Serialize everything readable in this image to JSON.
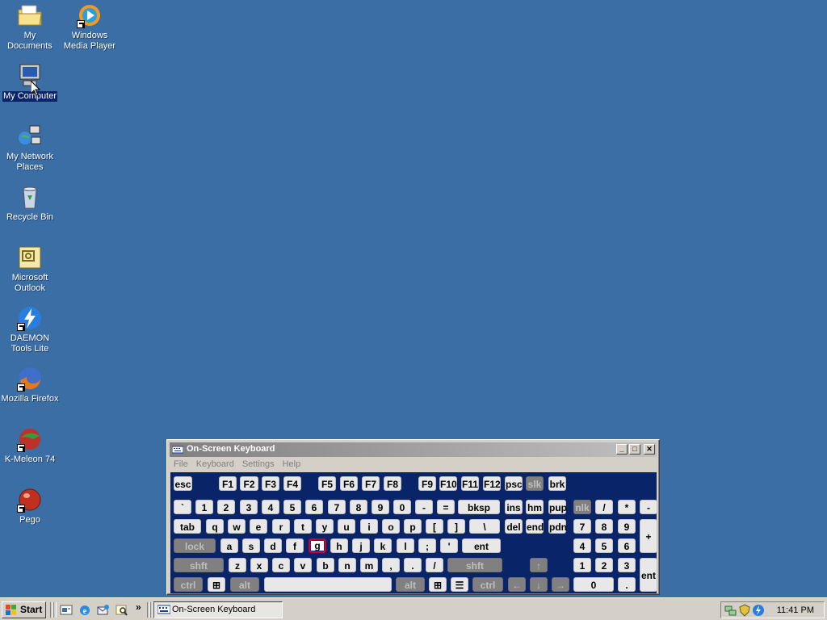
{
  "desktop": {
    "icons": [
      {
        "label": "My Documents",
        "icon": "folder-icon"
      },
      {
        "label": "Windows Media Player",
        "icon": "media-player-icon"
      },
      {
        "label": "My Computer",
        "icon": "computer-icon",
        "selected": true
      },
      {
        "label": "My Network Places",
        "icon": "network-icon"
      },
      {
        "label": "Recycle Bin",
        "icon": "recycle-bin-icon"
      },
      {
        "label": "Microsoft Outlook",
        "icon": "outlook-icon"
      },
      {
        "label": "DAEMON Tools Lite",
        "icon": "daemon-tools-icon"
      },
      {
        "label": "Mozilla Firefox",
        "icon": "firefox-icon"
      },
      {
        "label": "K-Meleon 74",
        "icon": "k-meleon-icon"
      },
      {
        "label": "Pego",
        "icon": "pego-icon"
      }
    ],
    "background_color": "#3a6ea5"
  },
  "osk": {
    "title": "On-Screen Keyboard",
    "menu": [
      "File",
      "Keyboard",
      "Settings",
      "Help"
    ],
    "title_buttons": {
      "minimize": "_",
      "maximize": "□",
      "close": "✕"
    },
    "pressed_key": "g",
    "rows": {
      "fn": [
        "esc",
        "F1",
        "F2",
        "F3",
        "F4",
        "F5",
        "F6",
        "F7",
        "F8",
        "F9",
        "F10",
        "F11",
        "F12",
        "psc",
        "slk",
        "brk"
      ],
      "num": [
        "`",
        "1",
        "2",
        "3",
        "4",
        "5",
        "6",
        "7",
        "8",
        "9",
        "0",
        "-",
        "=",
        "bksp",
        "ins",
        "hm",
        "pup",
        "nlk",
        "/",
        "*",
        "-"
      ],
      "top": [
        "tab",
        "q",
        "w",
        "e",
        "r",
        "t",
        "y",
        "u",
        "i",
        "o",
        "p",
        "[",
        "]",
        "\\",
        "del",
        "end",
        "pdn",
        "7",
        "8",
        "9",
        "+"
      ],
      "home": [
        "lock",
        "a",
        "s",
        "d",
        "f",
        "g",
        "h",
        "j",
        "k",
        "l",
        ";",
        "'",
        "ent",
        "4",
        "5",
        "6"
      ],
      "bottom": [
        "shft",
        "z",
        "x",
        "c",
        "v",
        "b",
        "n",
        "m",
        ",",
        ".",
        "/",
        "shft",
        "↑",
        "1",
        "2",
        "3",
        "ent"
      ],
      "space": [
        "ctrl",
        "⊞",
        "alt",
        "",
        "alt",
        "⊞",
        "☰",
        "ctrl",
        "←",
        "↓",
        "→",
        "0",
        "."
      ]
    }
  },
  "taskbar": {
    "start_label": "Start",
    "more": "»",
    "task_label": "On-Screen Keyboard",
    "clock": "11:41 PM"
  }
}
